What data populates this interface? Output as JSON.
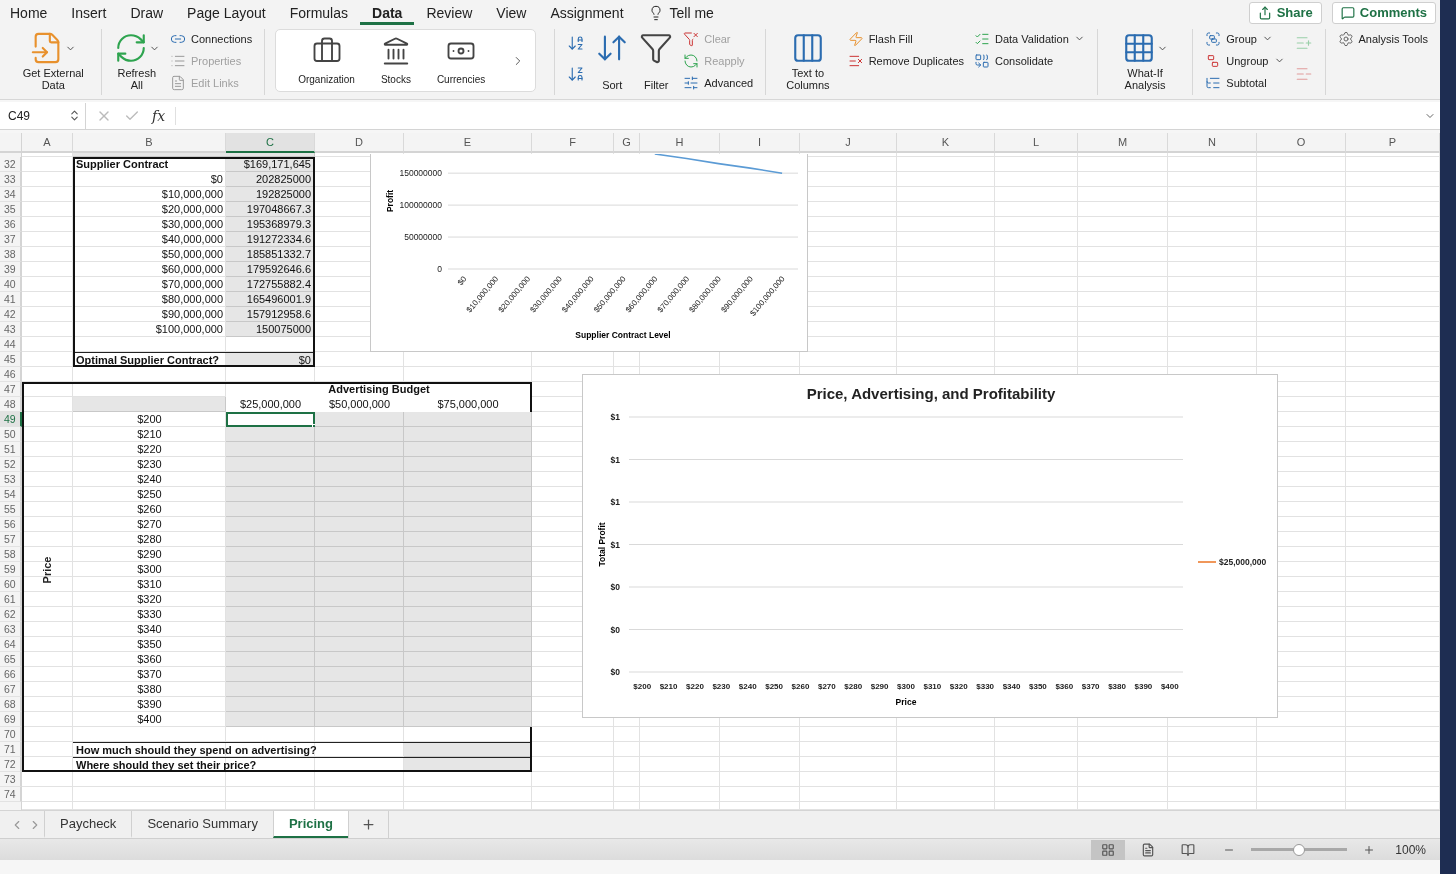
{
  "ribbon_tabs": [
    {
      "label": "Home",
      "selected": false
    },
    {
      "label": "Insert",
      "selected": false
    },
    {
      "label": "Draw",
      "selected": false
    },
    {
      "label": "Page Layout",
      "selected": false
    },
    {
      "label": "Formulas",
      "selected": false
    },
    {
      "label": "Data",
      "selected": true
    },
    {
      "label": "Review",
      "selected": false
    },
    {
      "label": "View",
      "selected": false
    },
    {
      "label": "Assignment",
      "selected": false
    }
  ],
  "tell_me": "Tell me",
  "share_button": "Share",
  "comments_button": "Comments",
  "ribbon_groups": [
    {
      "kind": "plain",
      "columns": [
        [
          {
            "kind": "large",
            "label": "Get External Data",
            "menu": true,
            "disabled": false
          }
        ]
      ]
    },
    {
      "kind": "plain",
      "columns": [
        [
          {
            "kind": "large",
            "label": "Refresh All",
            "menu": true,
            "disabled": false
          }
        ],
        [
          {
            "kind": "small",
            "label": "Connections",
            "menu": false,
            "disabled": false
          },
          {
            "kind": "small",
            "label": "Properties",
            "menu": false,
            "disabled": true
          },
          {
            "kind": "small",
            "label": "Edit Links",
            "menu": false,
            "disabled": true
          }
        ]
      ]
    },
    {
      "kind": "gallery",
      "columns": [
        [
          {
            "kind": "datatype",
            "label": "Organization"
          }
        ],
        [
          {
            "kind": "datatype",
            "label": "Stocks"
          }
        ],
        [
          {
            "kind": "datatype",
            "label": "Currencies"
          }
        ],
        [
          {
            "kind": "scroll"
          }
        ]
      ]
    },
    {
      "kind": "plain",
      "columns": [
        [
          {
            "kind": "icon",
            "disabled": false
          },
          {
            "kind": "icon",
            "disabled": false
          }
        ],
        [
          {
            "kind": "large",
            "label": "Sort",
            "menu": false,
            "disabled": false
          }
        ],
        [
          {
            "kind": "large",
            "label": "Filter",
            "menu": false,
            "disabled": false
          }
        ],
        [
          {
            "kind": "small",
            "label": "Clear",
            "menu": false,
            "disabled": true
          },
          {
            "kind": "small",
            "label": "Reapply",
            "menu": false,
            "disabled": true
          },
          {
            "kind": "small",
            "label": "Advanced",
            "menu": false,
            "disabled": false
          }
        ]
      ]
    },
    {
      "kind": "plain",
      "columns": [
        [
          {
            "kind": "large",
            "label": "Text to Columns",
            "menu": false,
            "disabled": false
          }
        ],
        [
          {
            "kind": "small",
            "label": "Flash Fill",
            "menu": false,
            "disabled": false
          },
          {
            "kind": "small",
            "label": "Remove Duplicates",
            "menu": false,
            "disabled": false
          }
        ],
        [
          {
            "kind": "small",
            "label": "Data Validation",
            "menu": true,
            "disabled": false
          },
          {
            "kind": "small",
            "label": "Consolidate",
            "menu": false,
            "disabled": false
          }
        ]
      ]
    },
    {
      "kind": "plain",
      "columns": [
        [
          {
            "kind": "large",
            "label": "What-If Analysis",
            "menu": true,
            "disabled": false
          }
        ]
      ]
    },
    {
      "kind": "plain",
      "columns": [
        [
          {
            "kind": "small",
            "label": "Group",
            "menu": true,
            "disabled": false
          },
          {
            "kind": "small",
            "label": "Ungroup",
            "menu": true,
            "disabled": false
          },
          {
            "kind": "small",
            "label": "Subtotal",
            "menu": false,
            "disabled": false
          }
        ],
        [
          {
            "kind": "icon",
            "disabled": true
          },
          {
            "kind": "icon",
            "disabled": true
          }
        ]
      ]
    },
    {
      "kind": "plain",
      "columns": [
        [
          {
            "kind": "small",
            "label": "Analysis Tools",
            "menu": false,
            "disabled": false
          }
        ]
      ]
    }
  ],
  "formula_bar": {
    "name_box": "C49",
    "function_label": "fx"
  },
  "columns": [
    {
      "label": "A",
      "selected": false
    },
    {
      "label": "B",
      "selected": false
    },
    {
      "label": "C",
      "selected": true
    },
    {
      "label": "D",
      "selected": false
    },
    {
      "label": "E",
      "selected": false
    },
    {
      "label": "F",
      "selected": false
    },
    {
      "label": "G",
      "selected": false
    },
    {
      "label": "H",
      "selected": false
    },
    {
      "label": "I",
      "selected": false
    },
    {
      "label": "J",
      "selected": false
    },
    {
      "label": "K",
      "selected": false
    },
    {
      "label": "L",
      "selected": false
    },
    {
      "label": "M",
      "selected": false
    },
    {
      "label": "N",
      "selected": false
    },
    {
      "label": "O",
      "selected": false
    },
    {
      "label": "P",
      "selected": false
    }
  ],
  "rows": [
    {
      "number": "32",
      "selected": false
    },
    {
      "number": "33",
      "selected": false
    },
    {
      "number": "34",
      "selected": false
    },
    {
      "number": "35",
      "selected": false
    },
    {
      "number": "36",
      "selected": false
    },
    {
      "number": "37",
      "selected": false
    },
    {
      "number": "38",
      "selected": false
    },
    {
      "number": "39",
      "selected": false
    },
    {
      "number": "40",
      "selected": false
    },
    {
      "number": "41",
      "selected": false
    },
    {
      "number": "42",
      "selected": false
    },
    {
      "number": "43",
      "selected": false
    },
    {
      "number": "44",
      "selected": false
    },
    {
      "number": "45",
      "selected": false
    },
    {
      "number": "46",
      "selected": false
    },
    {
      "number": "47",
      "selected": false
    },
    {
      "number": "48",
      "selected": false
    },
    {
      "number": "49",
      "selected": true
    },
    {
      "number": "50",
      "selected": false
    },
    {
      "number": "51",
      "selected": false
    },
    {
      "number": "52",
      "selected": false
    },
    {
      "number": "53",
      "selected": false
    },
    {
      "number": "54",
      "selected": false
    },
    {
      "number": "55",
      "selected": false
    },
    {
      "number": "56",
      "selected": false
    },
    {
      "number": "57",
      "selected": false
    },
    {
      "number": "58",
      "selected": false
    },
    {
      "number": "59",
      "selected": false
    },
    {
      "number": "60",
      "selected": false
    },
    {
      "number": "61",
      "selected": false
    },
    {
      "number": "62",
      "selected": false
    },
    {
      "number": "63",
      "selected": false
    },
    {
      "number": "64",
      "selected": false
    },
    {
      "number": "65",
      "selected": false
    },
    {
      "number": "66",
      "selected": false
    },
    {
      "number": "67",
      "selected": false
    },
    {
      "number": "68",
      "selected": false
    },
    {
      "number": "69",
      "selected": false
    },
    {
      "number": "70",
      "selected": false
    },
    {
      "number": "71",
      "selected": false
    },
    {
      "number": "72",
      "selected": false
    },
    {
      "number": "73",
      "selected": false
    },
    {
      "number": "74",
      "selected": false
    }
  ],
  "supplier_table": {
    "heading": "Supplier Contract",
    "heading_value": "$169,171,645",
    "rows": [
      {
        "level": "$0",
        "profit": "202825000"
      },
      {
        "level": "$10,000,000",
        "profit": "192825000"
      },
      {
        "level": "$20,000,000",
        "profit": "197048667.3"
      },
      {
        "level": "$30,000,000",
        "profit": "195368979.3"
      },
      {
        "level": "$40,000,000",
        "profit": "191272334.6"
      },
      {
        "level": "$50,000,000",
        "profit": "185851332.7"
      },
      {
        "level": "$60,000,000",
        "profit": "179592646.6"
      },
      {
        "level": "$70,000,000",
        "profit": "172755882.4"
      },
      {
        "level": "$80,000,000",
        "profit": "165496001.9"
      },
      {
        "level": "$90,000,000",
        "profit": "157912958.6"
      },
      {
        "level": "$100,000,000",
        "profit": "150075000"
      }
    ],
    "result_label": "Optimal Supplier Contract?",
    "result_value": "$0"
  },
  "supplier_chart": {
    "chart_data": {
      "type": "line",
      "xlabel": "Supplier Contract Level",
      "ylabel": "Profit",
      "categories": [
        "$0",
        "$10,000,000",
        "$20,000,000",
        "$30,000,000",
        "$40,000,000",
        "$50,000,000",
        "$60,000,000",
        "$70,000,000",
        "$80,000,000",
        "$90,000,000",
        "$100,000,000"
      ],
      "ylim": [
        0,
        180000000
      ],
      "yticks": [
        0,
        50000000,
        100000000,
        150000000
      ],
      "grid": true,
      "series": [
        {
          "color": "#5b9bd5",
          "values": [
            null,
            null,
            null,
            null,
            null,
            null,
            180000000,
            173000000,
            165000000,
            158000000,
            150000000
          ]
        }
      ]
    }
  },
  "advertising_table": {
    "title": "Advertising Budget",
    "budgets": [
      "$25,000,000",
      "$50,000,000",
      "$75,000,000"
    ],
    "axis_label": "Price",
    "prices": [
      {
        "price": "$200",
        "cells": [
          {
            "selected": true
          },
          {
            "selected": false
          },
          {
            "selected": false
          }
        ]
      },
      {
        "price": "$210",
        "cells": [
          {
            "selected": false
          },
          {
            "selected": false
          },
          {
            "selected": false
          }
        ]
      },
      {
        "price": "$220",
        "cells": [
          {
            "selected": false
          },
          {
            "selected": false
          },
          {
            "selected": false
          }
        ]
      },
      {
        "price": "$230",
        "cells": [
          {
            "selected": false
          },
          {
            "selected": false
          },
          {
            "selected": false
          }
        ]
      },
      {
        "price": "$240",
        "cells": [
          {
            "selected": false
          },
          {
            "selected": false
          },
          {
            "selected": false
          }
        ]
      },
      {
        "price": "$250",
        "cells": [
          {
            "selected": false
          },
          {
            "selected": false
          },
          {
            "selected": false
          }
        ]
      },
      {
        "price": "$260",
        "cells": [
          {
            "selected": false
          },
          {
            "selected": false
          },
          {
            "selected": false
          }
        ]
      },
      {
        "price": "$270",
        "cells": [
          {
            "selected": false
          },
          {
            "selected": false
          },
          {
            "selected": false
          }
        ]
      },
      {
        "price": "$280",
        "cells": [
          {
            "selected": false
          },
          {
            "selected": false
          },
          {
            "selected": false
          }
        ]
      },
      {
        "price": "$290",
        "cells": [
          {
            "selected": false
          },
          {
            "selected": false
          },
          {
            "selected": false
          }
        ]
      },
      {
        "price": "$300",
        "cells": [
          {
            "selected": false
          },
          {
            "selected": false
          },
          {
            "selected": false
          }
        ]
      },
      {
        "price": "$310",
        "cells": [
          {
            "selected": false
          },
          {
            "selected": false
          },
          {
            "selected": false
          }
        ]
      },
      {
        "price": "$320",
        "cells": [
          {
            "selected": false
          },
          {
            "selected": false
          },
          {
            "selected": false
          }
        ]
      },
      {
        "price": "$330",
        "cells": [
          {
            "selected": false
          },
          {
            "selected": false
          },
          {
            "selected": false
          }
        ]
      },
      {
        "price": "$340",
        "cells": [
          {
            "selected": false
          },
          {
            "selected": false
          },
          {
            "selected": false
          }
        ]
      },
      {
        "price": "$350",
        "cells": [
          {
            "selected": false
          },
          {
            "selected": false
          },
          {
            "selected": false
          }
        ]
      },
      {
        "price": "$360",
        "cells": [
          {
            "selected": false
          },
          {
            "selected": false
          },
          {
            "selected": false
          }
        ]
      },
      {
        "price": "$370",
        "cells": [
          {
            "selected": false
          },
          {
            "selected": false
          },
          {
            "selected": false
          }
        ]
      },
      {
        "price": "$380",
        "cells": [
          {
            "selected": false
          },
          {
            "selected": false
          },
          {
            "selected": false
          }
        ]
      },
      {
        "price": "$390",
        "cells": [
          {
            "selected": false
          },
          {
            "selected": false
          },
          {
            "selected": false
          }
        ]
      },
      {
        "price": "$400",
        "cells": [
          {
            "selected": false
          },
          {
            "selected": false
          },
          {
            "selected": false
          }
        ]
      }
    ],
    "questions": [
      "How much should they spend on advertising?",
      "Where should they set their price?"
    ]
  },
  "profit_chart": {
    "chart_data": {
      "type": "line",
      "title": "Price, Advertising, and Profitability",
      "xlabel": "Price",
      "ylabel": "Total Profit",
      "categories": [
        "$200",
        "$210",
        "$220",
        "$230",
        "$240",
        "$250",
        "$260",
        "$270",
        "$280",
        "$290",
        "$300",
        "$310",
        "$320",
        "$330",
        "$340",
        "$350",
        "$360",
        "$370",
        "$380",
        "$390",
        "$400"
      ],
      "ylim": [
        0,
        1.2
      ],
      "grid": true,
      "yticks": [
        {
          "value": 0,
          "label": "$0"
        },
        {
          "value": 0.2,
          "label": "$0"
        },
        {
          "value": 0.4,
          "label": "$0"
        },
        {
          "value": 0.6,
          "label": "$1"
        },
        {
          "value": 0.8,
          "label": "$1"
        },
        {
          "value": 1,
          "label": "$1"
        },
        {
          "value": 1.2,
          "label": "$1"
        }
      ],
      "series": [
        {
          "name": "$25,000,000",
          "color": "#ed7d31",
          "values": [
            null,
            null,
            null,
            null,
            null,
            null,
            null,
            null,
            null,
            null,
            null,
            null,
            null,
            null,
            null,
            null,
            null,
            null,
            null,
            null,
            null
          ]
        }
      ]
    }
  },
  "sheet_tabs": [
    {
      "label": "Paycheck",
      "selected": false
    },
    {
      "label": "Scenario Summary",
      "selected": false
    },
    {
      "label": "Pricing",
      "selected": true
    }
  ],
  "status_bar": {
    "views": [
      {
        "selected": true
      },
      {
        "selected": false
      },
      {
        "selected": false
      }
    ],
    "zoom": {
      "level": 0.5,
      "reading": "100%"
    }
  }
}
